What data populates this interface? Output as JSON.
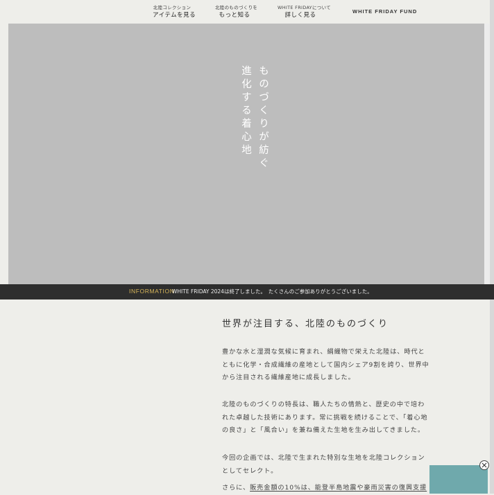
{
  "nav": {
    "items": [
      {
        "sub": "北陸コレクション",
        "main": "アイテムを見る"
      },
      {
        "sub": "北陸のものづくりを",
        "main": "もっと知る"
      },
      {
        "sub": "WHITE FRIDAYについて",
        "main": "詳しく見る"
      }
    ],
    "fund_label": "WHITE FRIDAY FUND"
  },
  "hero": {
    "line1": "ものづくりが紡ぐ",
    "line2": "進化する着心地"
  },
  "info": {
    "label": "INFORMATION",
    "text": "WHITE FRIDAY 2024は終了しました。　たくさんのご参加ありがとうございました。"
  },
  "section": {
    "title": "世界が注目する、北陸のものづくり",
    "p1": [
      "豊かな水と湿潤な気候に育まれ、絹織物で栄えた北陸は、時代と",
      "ともに化学・合成繊維の産地として国内シェア9割を誇り、世界中",
      "から注目される繊維産地に成長しました。"
    ],
    "p2": [
      "北陸のものづくりの特長は、職人たちの情熱と、歴史の中で培わ",
      "れた卓越した技術にあります。常に挑戦を続けることで、「着心地",
      "の良さ」と「風合い」を兼ね備えた生地を生み出してきました。"
    ],
    "p3": [
      "今回の企画では、北陸で生まれた特別な生地を北陸コレクション",
      "としてセレクト。"
    ],
    "p4_prefix": "さらに、",
    "p4_link": "販売金額の10%は、能登半島地震や豪雨災害の復興支援"
  },
  "colors": {
    "background": "#eeeeea",
    "hero": "#bdbdbd",
    "info_bar": "#2e2e2e",
    "info_label": "#d8b65a",
    "teal": "#6fa9ac"
  }
}
